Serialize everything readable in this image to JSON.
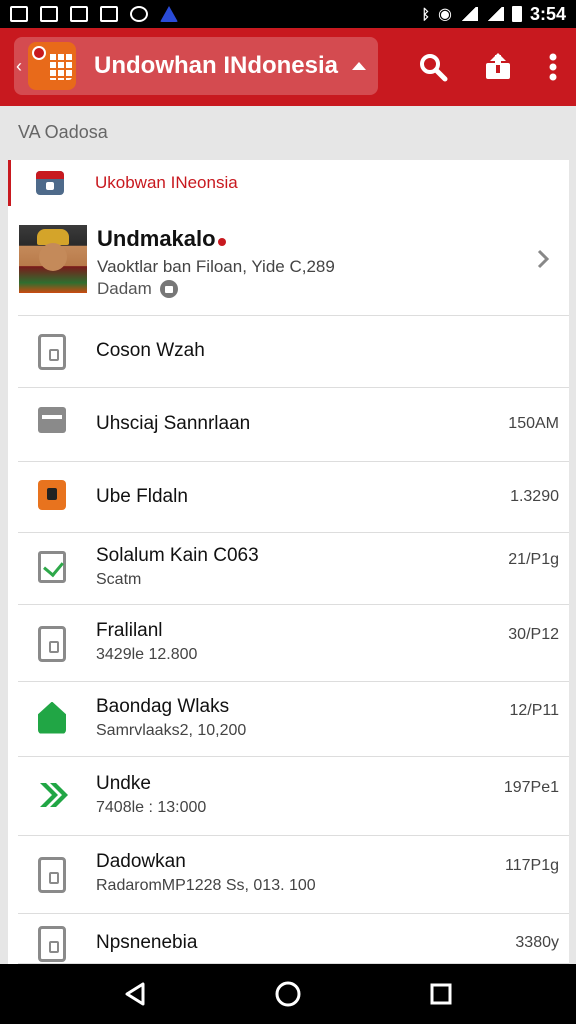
{
  "status_bar": {
    "time": "3:54"
  },
  "app_bar": {
    "title": "Undowhan INdonesia"
  },
  "section_label": "VA Oadosa",
  "card": {
    "header_label": "Ukobwan INeonsia",
    "profile": {
      "name": "Undmakalo",
      "subtitle": "Vaoktlar ban Filoan, Yide C,289",
      "subtitle2": "Dadam"
    },
    "rows": [
      {
        "title": "Coson Wzah",
        "subtitle": "",
        "value": "",
        "icon": "phone-icon"
      },
      {
        "title": "Uhsciaj Sannrlaan",
        "subtitle": "",
        "value": "150AM",
        "icon": "folder-icon"
      },
      {
        "title": "Ube Fldaln",
        "subtitle": "",
        "value": "1.3290",
        "icon": "orange-briefcase-icon"
      },
      {
        "title": "Solalum Kain C063",
        "subtitle": "Scatm",
        "value": "21/P1g",
        "icon": "checkbox-icon"
      },
      {
        "title": "Fralilanl",
        "subtitle": "3429le 12.800",
        "value": "30/P12",
        "icon": "phone-icon"
      },
      {
        "title": "Baondag Wlaks",
        "subtitle": "Samrvlaaks2, 10,200",
        "value": "12/P11",
        "icon": "green-home-icon"
      },
      {
        "title": "Undke",
        "subtitle": "7408le : 13:000",
        "value": "197Pe1",
        "icon": "green-arrow-icon"
      },
      {
        "title": "Dadowkan",
        "subtitle": "RadaromMP1228 Ss, 013. 100",
        "value": "117P1g",
        "icon": "phone-icon"
      },
      {
        "title": "Npsnenebia",
        "subtitle": "",
        "value": "3380y",
        "icon": "phone-icon"
      }
    ]
  },
  "colors": {
    "brand_red": "#c8191f",
    "green": "#21a645",
    "orange": "#e8731e"
  }
}
